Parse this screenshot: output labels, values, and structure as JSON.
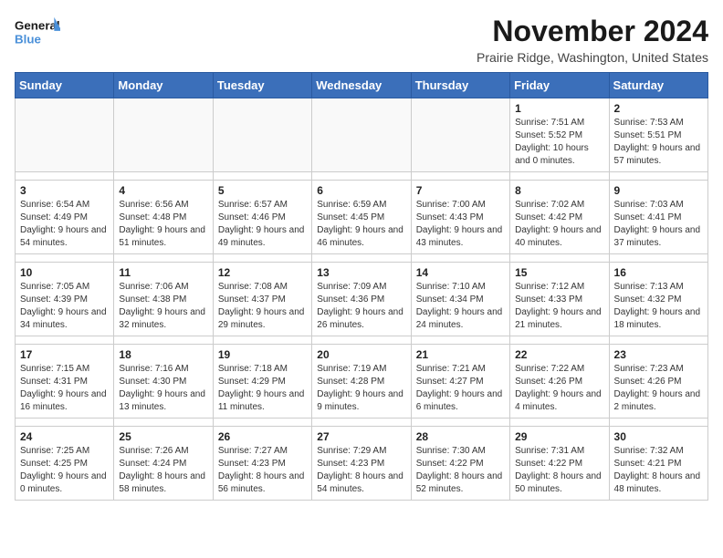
{
  "logo": {
    "line1": "General",
    "line2": "Blue"
  },
  "title": "November 2024",
  "subtitle": "Prairie Ridge, Washington, United States",
  "weekdays": [
    "Sunday",
    "Monday",
    "Tuesday",
    "Wednesday",
    "Thursday",
    "Friday",
    "Saturday"
  ],
  "weeks": [
    [
      {
        "day": "",
        "info": ""
      },
      {
        "day": "",
        "info": ""
      },
      {
        "day": "",
        "info": ""
      },
      {
        "day": "",
        "info": ""
      },
      {
        "day": "",
        "info": ""
      },
      {
        "day": "1",
        "info": "Sunrise: 7:51 AM\nSunset: 5:52 PM\nDaylight: 10 hours and 0 minutes."
      },
      {
        "day": "2",
        "info": "Sunrise: 7:53 AM\nSunset: 5:51 PM\nDaylight: 9 hours and 57 minutes."
      }
    ],
    [
      {
        "day": "3",
        "info": "Sunrise: 6:54 AM\nSunset: 4:49 PM\nDaylight: 9 hours and 54 minutes."
      },
      {
        "day": "4",
        "info": "Sunrise: 6:56 AM\nSunset: 4:48 PM\nDaylight: 9 hours and 51 minutes."
      },
      {
        "day": "5",
        "info": "Sunrise: 6:57 AM\nSunset: 4:46 PM\nDaylight: 9 hours and 49 minutes."
      },
      {
        "day": "6",
        "info": "Sunrise: 6:59 AM\nSunset: 4:45 PM\nDaylight: 9 hours and 46 minutes."
      },
      {
        "day": "7",
        "info": "Sunrise: 7:00 AM\nSunset: 4:43 PM\nDaylight: 9 hours and 43 minutes."
      },
      {
        "day": "8",
        "info": "Sunrise: 7:02 AM\nSunset: 4:42 PM\nDaylight: 9 hours and 40 minutes."
      },
      {
        "day": "9",
        "info": "Sunrise: 7:03 AM\nSunset: 4:41 PM\nDaylight: 9 hours and 37 minutes."
      }
    ],
    [
      {
        "day": "10",
        "info": "Sunrise: 7:05 AM\nSunset: 4:39 PM\nDaylight: 9 hours and 34 minutes."
      },
      {
        "day": "11",
        "info": "Sunrise: 7:06 AM\nSunset: 4:38 PM\nDaylight: 9 hours and 32 minutes."
      },
      {
        "day": "12",
        "info": "Sunrise: 7:08 AM\nSunset: 4:37 PM\nDaylight: 9 hours and 29 minutes."
      },
      {
        "day": "13",
        "info": "Sunrise: 7:09 AM\nSunset: 4:36 PM\nDaylight: 9 hours and 26 minutes."
      },
      {
        "day": "14",
        "info": "Sunrise: 7:10 AM\nSunset: 4:34 PM\nDaylight: 9 hours and 24 minutes."
      },
      {
        "day": "15",
        "info": "Sunrise: 7:12 AM\nSunset: 4:33 PM\nDaylight: 9 hours and 21 minutes."
      },
      {
        "day": "16",
        "info": "Sunrise: 7:13 AM\nSunset: 4:32 PM\nDaylight: 9 hours and 18 minutes."
      }
    ],
    [
      {
        "day": "17",
        "info": "Sunrise: 7:15 AM\nSunset: 4:31 PM\nDaylight: 9 hours and 16 minutes."
      },
      {
        "day": "18",
        "info": "Sunrise: 7:16 AM\nSunset: 4:30 PM\nDaylight: 9 hours and 13 minutes."
      },
      {
        "day": "19",
        "info": "Sunrise: 7:18 AM\nSunset: 4:29 PM\nDaylight: 9 hours and 11 minutes."
      },
      {
        "day": "20",
        "info": "Sunrise: 7:19 AM\nSunset: 4:28 PM\nDaylight: 9 hours and 9 minutes."
      },
      {
        "day": "21",
        "info": "Sunrise: 7:21 AM\nSunset: 4:27 PM\nDaylight: 9 hours and 6 minutes."
      },
      {
        "day": "22",
        "info": "Sunrise: 7:22 AM\nSunset: 4:26 PM\nDaylight: 9 hours and 4 minutes."
      },
      {
        "day": "23",
        "info": "Sunrise: 7:23 AM\nSunset: 4:26 PM\nDaylight: 9 hours and 2 minutes."
      }
    ],
    [
      {
        "day": "24",
        "info": "Sunrise: 7:25 AM\nSunset: 4:25 PM\nDaylight: 9 hours and 0 minutes."
      },
      {
        "day": "25",
        "info": "Sunrise: 7:26 AM\nSunset: 4:24 PM\nDaylight: 8 hours and 58 minutes."
      },
      {
        "day": "26",
        "info": "Sunrise: 7:27 AM\nSunset: 4:23 PM\nDaylight: 8 hours and 56 minutes."
      },
      {
        "day": "27",
        "info": "Sunrise: 7:29 AM\nSunset: 4:23 PM\nDaylight: 8 hours and 54 minutes."
      },
      {
        "day": "28",
        "info": "Sunrise: 7:30 AM\nSunset: 4:22 PM\nDaylight: 8 hours and 52 minutes."
      },
      {
        "day": "29",
        "info": "Sunrise: 7:31 AM\nSunset: 4:22 PM\nDaylight: 8 hours and 50 minutes."
      },
      {
        "day": "30",
        "info": "Sunrise: 7:32 AM\nSunset: 4:21 PM\nDaylight: 8 hours and 48 minutes."
      }
    ]
  ]
}
